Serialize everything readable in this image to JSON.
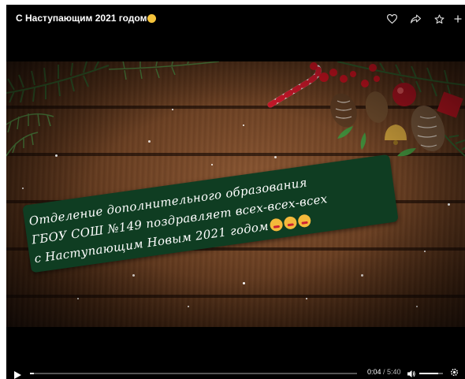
{
  "video": {
    "title": "С Наступающим 2021 годом",
    "title_emoji": "smiling-face-emoji",
    "message_lines": [
      "Отделение дополнительного образования",
      "ГБОУ СОШ №149 поздравляет всех-всех-всех",
      "с Наступающим Новым 2021 годом"
    ],
    "message_emojis": [
      "partying-face-emoji",
      "partying-face-emoji",
      "partying-face-emoji"
    ]
  },
  "top_icons": [
    "heart-icon",
    "share-icon",
    "star-icon",
    "plus-icon"
  ],
  "playback": {
    "current_time": "0:04",
    "separator": " / ",
    "duration": "5:40",
    "progress_fraction": 0.012,
    "volume_fraction": 0.8
  },
  "colors": {
    "player_bg": "#000000",
    "message_box": "#0f3d22",
    "text": "#ffffff"
  }
}
